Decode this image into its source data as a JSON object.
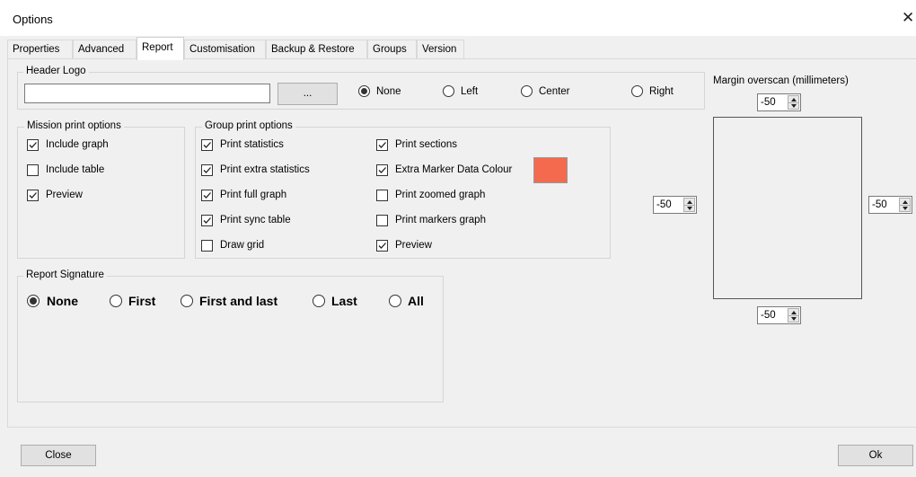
{
  "window": {
    "title": "Options",
    "close_glyph": "✕"
  },
  "tabs": [
    {
      "label": "Properties"
    },
    {
      "label": "Advanced"
    },
    {
      "label": "Report",
      "active": true
    },
    {
      "label": "Customisation"
    },
    {
      "label": "Backup & Restore"
    },
    {
      "label": "Groups"
    },
    {
      "label": "Version"
    }
  ],
  "header_logo": {
    "label": "Header Logo",
    "path_value": "",
    "browse_label": "...",
    "alignment": [
      {
        "label": "None",
        "selected": true
      },
      {
        "label": "Left",
        "selected": false
      },
      {
        "label": "Center",
        "selected": false
      },
      {
        "label": "Right",
        "selected": false
      }
    ]
  },
  "mission_print": {
    "label": "Mission print options",
    "options": [
      {
        "label": "Include graph",
        "checked": true
      },
      {
        "label": "Include table",
        "checked": false
      },
      {
        "label": "Preview",
        "checked": true
      }
    ]
  },
  "group_print": {
    "label": "Group print options",
    "left_options": [
      {
        "label": "Print statistics",
        "checked": true
      },
      {
        "label": "Print extra statistics",
        "checked": true
      },
      {
        "label": "Print full graph",
        "checked": true
      },
      {
        "label": "Print sync table",
        "checked": true
      },
      {
        "label": "Draw grid",
        "checked": false
      }
    ],
    "right_options": [
      {
        "label": "Print sections",
        "checked": true
      },
      {
        "label": "Extra Marker Data Colour",
        "checked": true
      },
      {
        "label": "Print zoomed graph",
        "checked": false
      },
      {
        "label": "Print markers graph",
        "checked": false
      },
      {
        "label": "Preview",
        "checked": true
      }
    ],
    "marker_colour": "#f46a4e"
  },
  "report_signature": {
    "label": "Report Signature",
    "options": [
      {
        "label": "None",
        "selected": true
      },
      {
        "label": "First",
        "selected": false
      },
      {
        "label": "First and last",
        "selected": false
      },
      {
        "label": "Last",
        "selected": false
      },
      {
        "label": "All",
        "selected": false
      }
    ]
  },
  "margin": {
    "label": "Margin overscan (millimeters)",
    "top": "-50",
    "left": "-50",
    "right": "-50",
    "bottom": "-50"
  },
  "footer": {
    "close_label": "Close",
    "ok_label": "Ok"
  }
}
